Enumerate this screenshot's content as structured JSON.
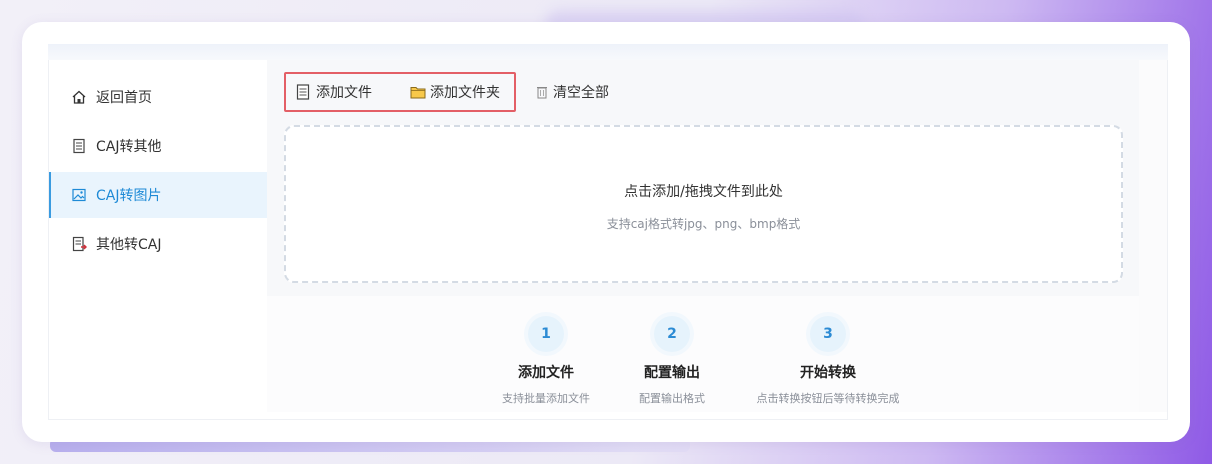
{
  "sidebar": {
    "items": [
      {
        "label": "返回首页",
        "icon": "home-icon",
        "active": false
      },
      {
        "label": "CAJ转其他",
        "icon": "document-icon",
        "active": false
      },
      {
        "label": "CAJ转图片",
        "icon": "image-icon",
        "active": true
      },
      {
        "label": "其他转CAJ",
        "icon": "document-convert-icon",
        "active": false
      }
    ]
  },
  "toolbar": {
    "add_file": "添加文件",
    "add_folder": "添加文件夹",
    "clear_all": "清空全部"
  },
  "drop_zone": {
    "title": "点击添加/拖拽文件到此处",
    "subtitle": "支持caj格式转jpg、png、bmp格式"
  },
  "steps": [
    {
      "number": "1",
      "title": "添加文件",
      "desc": "支持批量添加文件"
    },
    {
      "number": "2",
      "title": "配置输出",
      "desc": "配置输出格式"
    },
    {
      "number": "3",
      "title": "开始转换",
      "desc": "点击转换按钮后等待转换完成"
    }
  ],
  "colors": {
    "accent": "#1e8ad6",
    "highlight_border": "#e35f66",
    "active_bg": "#e9f4fd"
  }
}
